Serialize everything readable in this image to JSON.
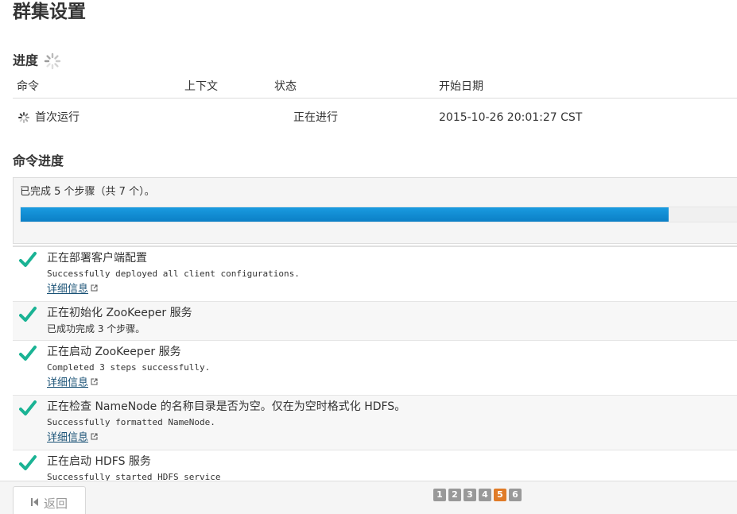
{
  "page": {
    "title": "群集设置"
  },
  "progress_section": {
    "heading": "进度",
    "columns": {
      "command": "命令",
      "context": "上下文",
      "status": "状态",
      "start_date": "开始日期"
    },
    "row": {
      "command": "首次运行",
      "context": "",
      "status": "正在进行",
      "start_date": "2015-10-26 20:01:27 CST"
    }
  },
  "command_progress": {
    "heading": "命令进度",
    "summary": "已完成 5 个步骤（共 7 个）。",
    "completed": 5,
    "total": 7,
    "fill_fraction": 0.905,
    "bar_color": "#1a8fd6"
  },
  "steps": [
    {
      "title": "正在部署客户端配置",
      "message": "Successfully deployed all client configurations.",
      "detail_link": "详细信息"
    },
    {
      "title": "正在初始化 ZooKeeper 服务",
      "message": "已成功完成 3 个步骤。",
      "detail_link": ""
    },
    {
      "title": "正在启动 ZooKeeper 服务",
      "message": "Completed 3 steps successfully.",
      "detail_link": "详细信息"
    },
    {
      "title": "正在检查 NameNode 的名称目录是否为空。仅在为空时格式化 HDFS。",
      "message": "Successfully formatted NameNode.",
      "detail_link": "详细信息"
    },
    {
      "title": "正在启动 HDFS 服务",
      "message": "Successfully started HDFS service",
      "detail_link": ""
    }
  ],
  "icons": {
    "step_status": "check-icon",
    "spinner": "spinner-icon",
    "external": "external-link-icon",
    "back": "back-arrow-icon"
  },
  "colors": {
    "check": "#1ab394",
    "pager": "#999999",
    "pager_active": "#e07b27",
    "link": "#1a5276"
  },
  "footer": {
    "back_label": "返回",
    "pages": [
      "1",
      "2",
      "3",
      "4",
      "5",
      "6"
    ],
    "active_page": "5"
  }
}
